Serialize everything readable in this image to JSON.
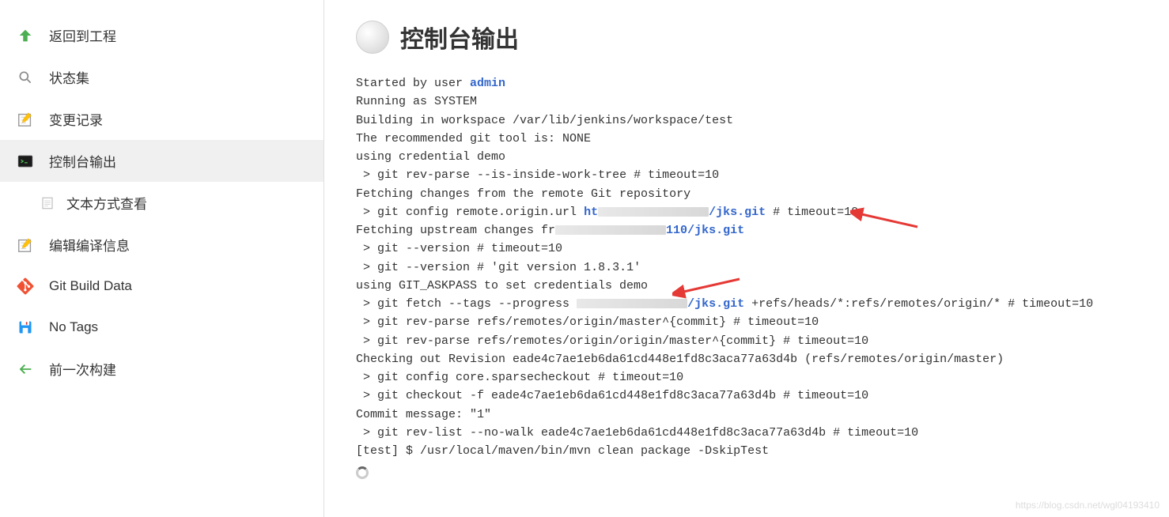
{
  "sidebar": {
    "items": [
      {
        "label": "返回到工程"
      },
      {
        "label": "状态集"
      },
      {
        "label": "变更记录"
      },
      {
        "label": "控制台输出"
      },
      {
        "label": "文本方式查看"
      },
      {
        "label": "编辑编译信息"
      },
      {
        "label": "Git Build Data"
      },
      {
        "label": "No Tags"
      },
      {
        "label": "前一次构建"
      }
    ]
  },
  "page": {
    "title": "控制台输出"
  },
  "console": {
    "started_by": "Started by user ",
    "user": "admin",
    "running_as": "Running as SYSTEM",
    "building": "Building in workspace /var/lib/jenkins/workspace/test",
    "recommended": "The recommended git tool is: NONE",
    "credential": "using credential demo",
    "rev_parse1": " > git rev-parse --is-inside-work-tree # timeout=10",
    "fetching_changes": "Fetching changes from the remote Git repository",
    "config_remote_pre": " > git config remote.origin.url ",
    "url_prefix": "ht",
    "jks_git": "/jks.git",
    "timeout10": " # timeout=10",
    "fetching_upstream_pre": "Fetching upstream changes fr",
    "num_frag": "110",
    "version1": " > git --version # timeout=10",
    "version2": " > git --version # 'git version 1.8.3.1'",
    "askpass": "using GIT_ASKPASS to set credentials demo",
    "fetch_pre": " > git fetch --tags --progress ",
    "fetch_post": " +refs/heads/*:refs/remotes/origin/* # timeout=10",
    "rev_parse2": " > git rev-parse refs/remotes/origin/master^{commit} # timeout=10",
    "rev_parse3": " > git rev-parse refs/remotes/origin/origin/master^{commit} # timeout=10",
    "checking_out": "Checking out Revision eade4c7ae1eb6da61cd448e1fd8c3aca77a63d4b (refs/remotes/origin/master)",
    "sparse": " > git config core.sparsecheckout # timeout=10",
    "checkout": " > git checkout -f eade4c7ae1eb6da61cd448e1fd8c3aca77a63d4b # timeout=10",
    "commit_msg": "Commit message: \"1\"",
    "rev_list": " > git rev-list --no-walk eade4c7ae1eb6da61cd448e1fd8c3aca77a63d4b # timeout=10",
    "mvn": "[test] $ /usr/local/maven/bin/mvn clean package -DskipTest"
  },
  "watermark": "https://blog.csdn.net/wgl04193410"
}
